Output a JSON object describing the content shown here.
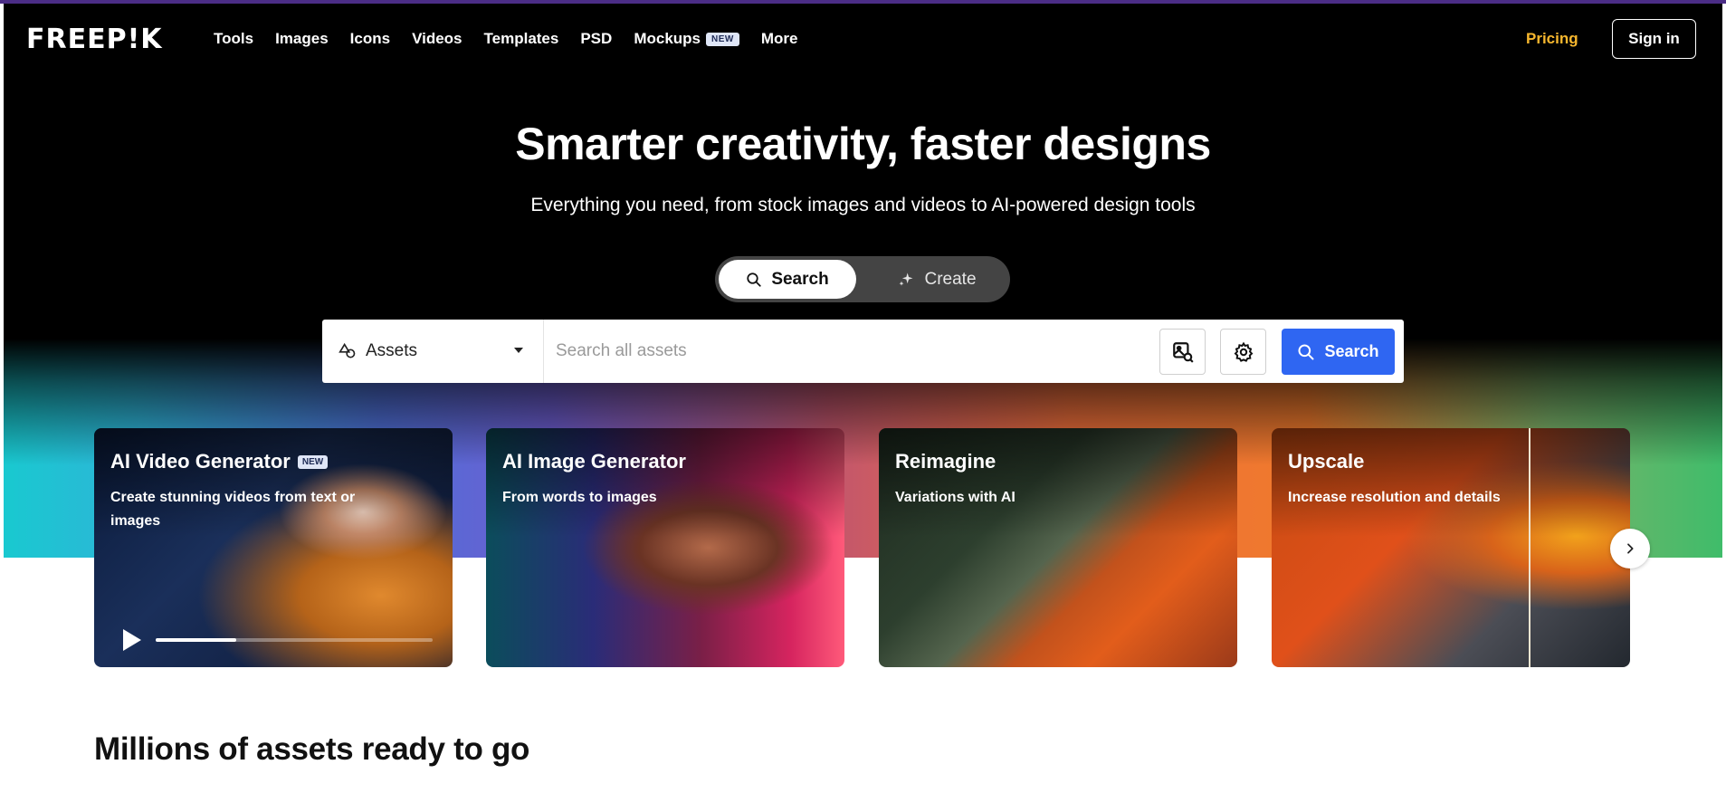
{
  "brand": {
    "logo_text": "FREEP!K"
  },
  "nav": {
    "links": [
      "Tools",
      "Images",
      "Icons",
      "Videos",
      "Templates",
      "PSD",
      "Mockups",
      "More"
    ],
    "mockups_badge": "NEW",
    "pricing": "Pricing",
    "signin": "Sign in"
  },
  "hero": {
    "title": "Smarter creativity, faster designs",
    "subtitle": "Everything you need, from stock images and videos to AI-powered design tools"
  },
  "mode_toggle": {
    "search": "Search",
    "create": "Create"
  },
  "search": {
    "category": "Assets",
    "placeholder": "Search all assets",
    "button": "Search"
  },
  "cards": [
    {
      "title": "AI Video Generator",
      "badge": "NEW",
      "subtitle": "Create stunning videos from text or images",
      "video_progress_fraction": 0.29
    },
    {
      "title": "AI Image Generator",
      "subtitle": "From words to images"
    },
    {
      "title": "Reimagine",
      "subtitle": "Variations with AI"
    },
    {
      "title": "Upscale",
      "subtitle": "Increase resolution and details"
    }
  ],
  "section": {
    "title": "Millions of assets ready to go"
  },
  "colors": {
    "accent_blue": "#2f66f2",
    "pricing": "#f7b72e",
    "hero_bg": "#000000"
  }
}
